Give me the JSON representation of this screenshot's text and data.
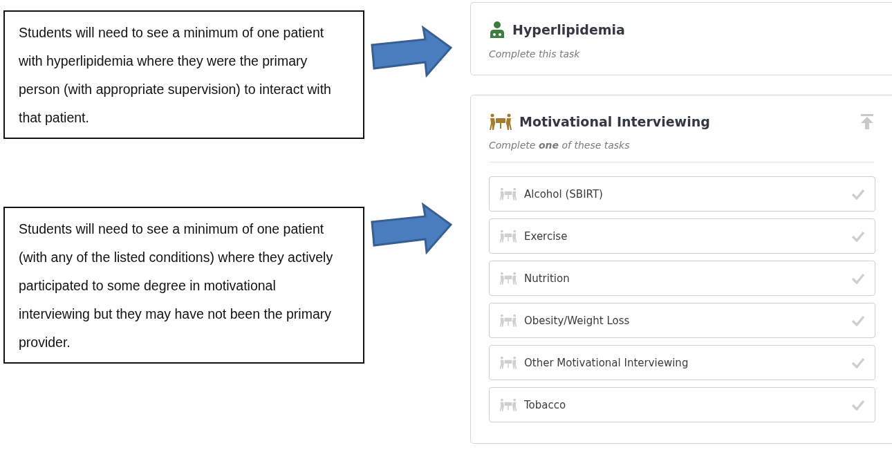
{
  "callouts": [
    {
      "text": "Students will need to see a minimum of one patient with hyperlipidemia where they were the primary person (with appropriate supervision) to interact with that patient."
    },
    {
      "text": "Students will need to see a minimum of one patient (with any of the listed conditions) where they actively participated to some degree in motivational interviewing but they may have not been the primary provider."
    }
  ],
  "cards": [
    {
      "kind": "single",
      "title": "Hyperlipidemia",
      "color": "#3d7d3f",
      "subtitle": "Complete this task"
    },
    {
      "kind": "group",
      "title": "Motivational Interviewing",
      "color": "#a57b2e",
      "subtitle": "Complete **one** of these tasks",
      "tasks": [
        {
          "label": "Alcohol (SBIRT)",
          "completed": false
        },
        {
          "label": "Exercise",
          "completed": false
        },
        {
          "label": "Nutrition",
          "completed": false
        },
        {
          "label": "Obesity/Weight Loss",
          "completed": false
        },
        {
          "label": "Other Motivational Interviewing",
          "completed": false
        },
        {
          "label": "Tobacco",
          "completed": false
        }
      ]
    }
  ]
}
